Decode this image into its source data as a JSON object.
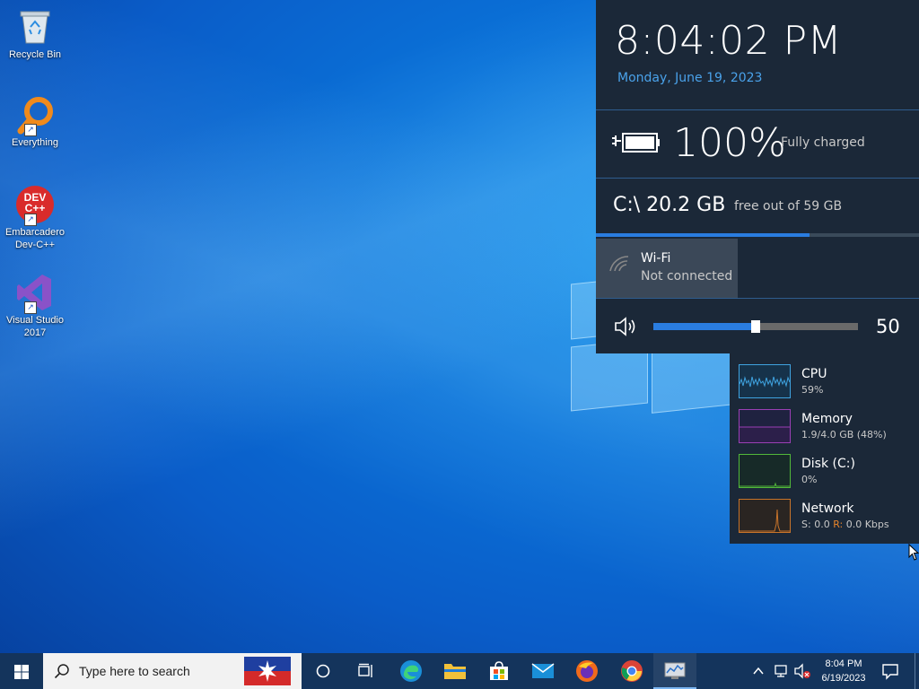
{
  "desktop": {
    "icons": [
      {
        "label": "Recycle Bin"
      },
      {
        "label": "Everything"
      },
      {
        "label": "Embarcadero Dev-C++",
        "logo_text": "DEV C++"
      },
      {
        "label": "Visual Studio 2017"
      }
    ]
  },
  "flyout": {
    "time": "8:04:02 PM",
    "date": "Monday, June 19, 2023",
    "battery": {
      "percent": "100%",
      "status": "Fully charged"
    },
    "drive": {
      "label": "C:\\  20.2 GB",
      "free_text": "free out of 59 GB",
      "used_fraction": 0.66
    },
    "wifi": {
      "title": "Wi-Fi",
      "status": "Not connected"
    },
    "volume": {
      "value": "50",
      "level_fraction": 0.5
    }
  },
  "performance": {
    "items": [
      {
        "title": "CPU",
        "value": "59%",
        "color": "#3fa3e0"
      },
      {
        "title": "Memory",
        "value": "1.9/4.0 GB (48%)",
        "color": "#9b3fb5"
      },
      {
        "title": "Disk (C:)",
        "value": "0%",
        "color": "#52b83a"
      },
      {
        "title": "Network",
        "value_s_label": "S:",
        "value_s": "0.0",
        "value_r_label": "R:",
        "value_r": "0.0 Kbps",
        "color": "#c8742a"
      }
    ]
  },
  "taskbar": {
    "search_placeholder": "Type here to search",
    "time": "8:04 PM",
    "date": "6/19/2023"
  }
}
